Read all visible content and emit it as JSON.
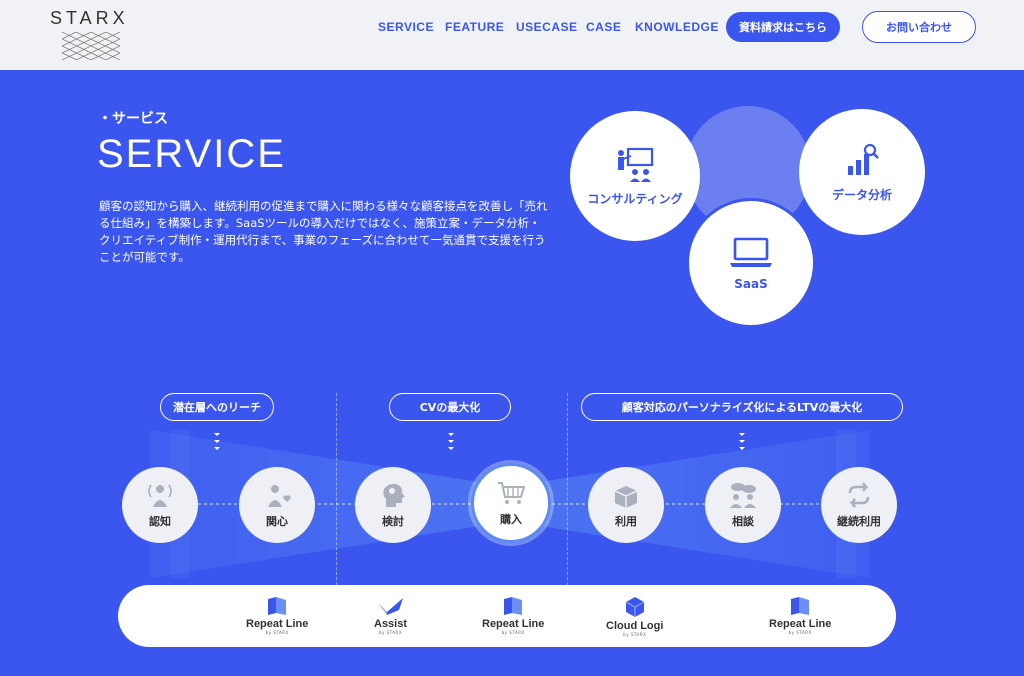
{
  "header": {
    "logo": "STARX",
    "nav": [
      "SERVICE",
      "FEATURE",
      "USECASE",
      "CASE",
      "KNOWLEDGE"
    ],
    "cta_primary": "資料請求はこちら",
    "cta_secondary": "お問い合わせ"
  },
  "intro": {
    "subtitle": "・サービス",
    "title": "SERVICE",
    "description": "顧客の認知から購入、継続利用の促進まで購入に関わる様々な顧客接点を改善し「売れる仕組み」を構築します。SaaSツールの導入だけではなく、施策立案・データ分析・クリエイティブ制作・運用代行まで、事業のフェーズに合わせて一気通貫で支援を行うことが可能です。"
  },
  "services": {
    "consulting": "コンサルティング",
    "data": "データ分析",
    "saas": "SaaS"
  },
  "journey": {
    "phases": [
      "潜在層へのリーチ",
      "CVの最大化",
      "顧客対応のパーソナライズ化によるLTVの最大化"
    ],
    "steps": [
      "認知",
      "関心",
      "検討",
      "購入",
      "利用",
      "相談",
      "継続利用"
    ]
  },
  "products": {
    "p1": "Repeat Line",
    "p2": "Assist",
    "p3": "Repeat Line",
    "p4": "Cloud Logi",
    "p5": "Repeat Line",
    "by": "by STARX"
  },
  "colors": {
    "brand": "#3b56ee",
    "header_bg": "#f1f2f5"
  }
}
